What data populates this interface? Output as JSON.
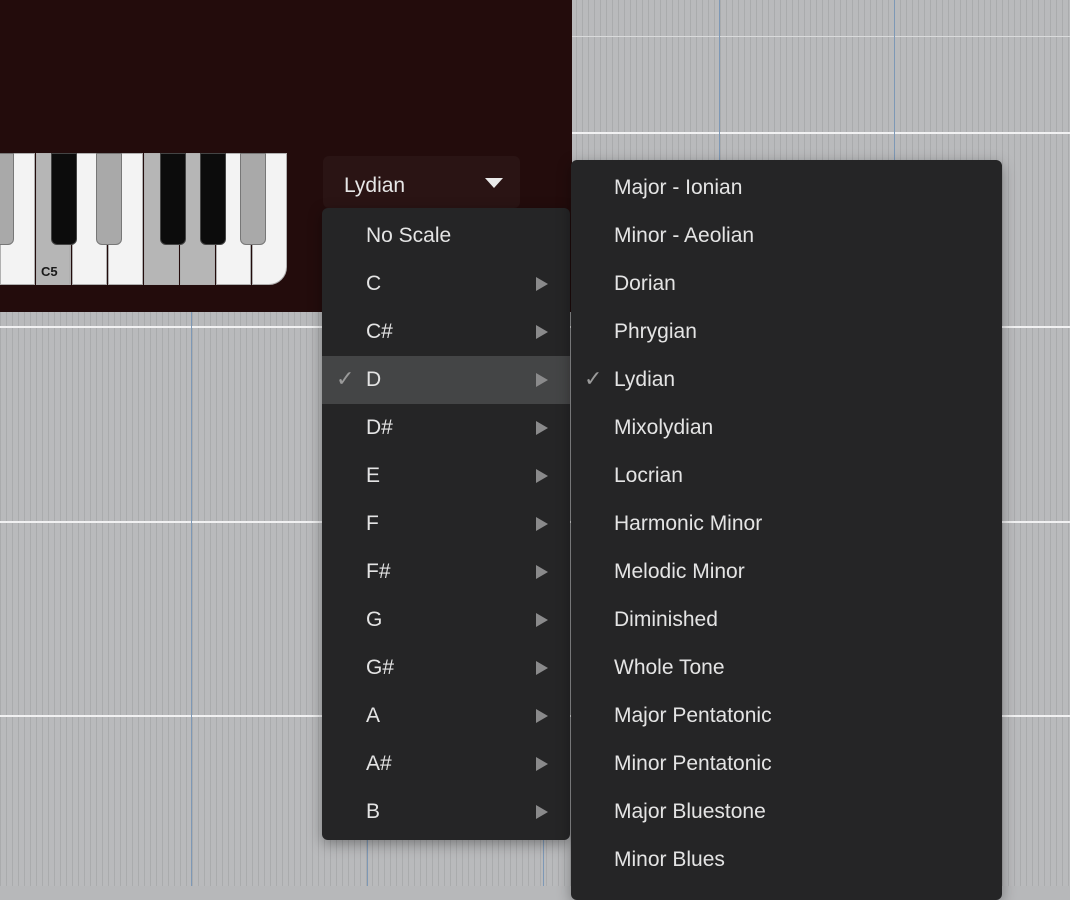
{
  "keyboard": {
    "octave_label": "C5"
  },
  "scale_selector": {
    "value": "Lydian"
  },
  "root_menu": {
    "items": [
      {
        "label": "No Scale",
        "submenu": false,
        "checked": false
      },
      {
        "label": "C",
        "submenu": true,
        "checked": false
      },
      {
        "label": "C#",
        "submenu": true,
        "checked": false
      },
      {
        "label": "D",
        "submenu": true,
        "checked": true
      },
      {
        "label": "D#",
        "submenu": true,
        "checked": false
      },
      {
        "label": "E",
        "submenu": true,
        "checked": false
      },
      {
        "label": "F",
        "submenu": true,
        "checked": false
      },
      {
        "label": "F#",
        "submenu": true,
        "checked": false
      },
      {
        "label": "G",
        "submenu": true,
        "checked": false
      },
      {
        "label": "G#",
        "submenu": true,
        "checked": false
      },
      {
        "label": "A",
        "submenu": true,
        "checked": false
      },
      {
        "label": "A#",
        "submenu": true,
        "checked": false
      },
      {
        "label": "B",
        "submenu": true,
        "checked": false
      }
    ],
    "check_mark": "✓"
  },
  "mode_menu": {
    "items": [
      {
        "label": "Major - Ionian",
        "checked": false
      },
      {
        "label": "Minor - Aeolian",
        "checked": false
      },
      {
        "label": "Dorian",
        "checked": false
      },
      {
        "label": "Phrygian",
        "checked": false
      },
      {
        "label": "Lydian",
        "checked": true
      },
      {
        "label": "Mixolydian",
        "checked": false
      },
      {
        "label": "Locrian",
        "checked": false
      },
      {
        "label": "Harmonic Minor",
        "checked": false
      },
      {
        "label": "Melodic Minor",
        "checked": false
      },
      {
        "label": "Diminished",
        "checked": false
      },
      {
        "label": "Whole Tone",
        "checked": false
      },
      {
        "label": "Major Pentatonic",
        "checked": false
      },
      {
        "label": "Minor Pentatonic",
        "checked": false
      },
      {
        "label": "Major Bluestone",
        "checked": false
      },
      {
        "label": "Minor Blues",
        "checked": false
      }
    ],
    "check_mark": "✓"
  },
  "colors": {
    "panel": "#230c0c",
    "menu_bg": "#252526",
    "highlight": "#444546",
    "grid": "#b9babc",
    "bar_line": "#7d98b6"
  }
}
